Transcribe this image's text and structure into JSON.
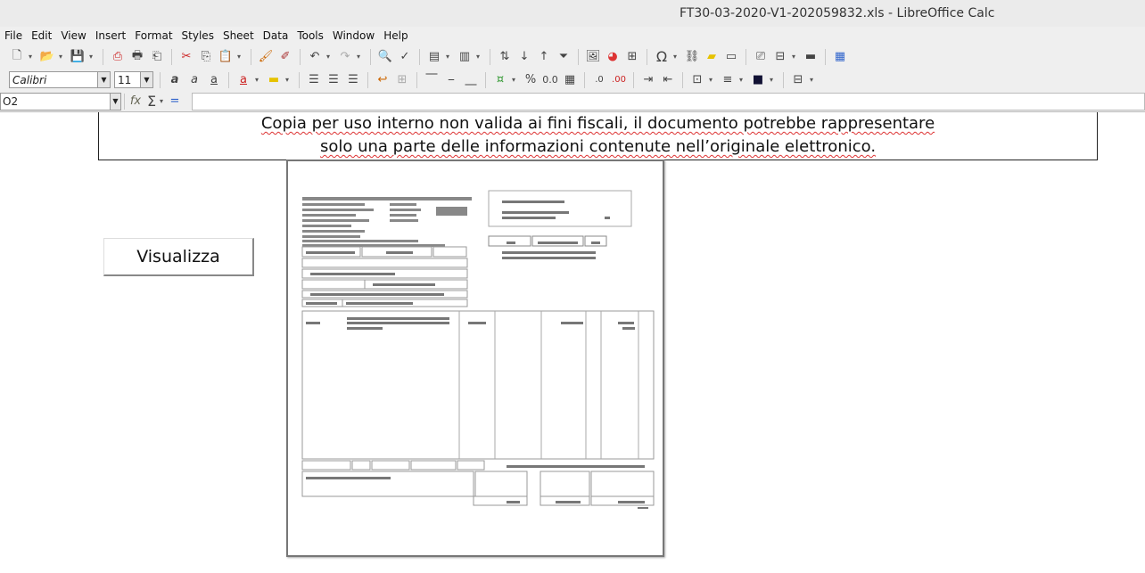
{
  "window": {
    "title": "FT30-03-2020-V1-202059832.xls - LibreOffice Calc"
  },
  "menu": [
    "File",
    "Edit",
    "View",
    "Insert",
    "Format",
    "Styles",
    "Sheet",
    "Data",
    "Tools",
    "Window",
    "Help"
  ],
  "formatting": {
    "font_name": "Calibri",
    "font_size": "11"
  },
  "formula_bar": {
    "cell_ref": "O2",
    "content": ""
  },
  "sheet": {
    "notice_line1": "Copia per uso interno non valida ai fini fiscali, il documento potrebbe rappresentare",
    "notice_line2": "solo una parte delle informazioni contenute nell’originale elettronico.",
    "button_label": "Visualizza"
  }
}
